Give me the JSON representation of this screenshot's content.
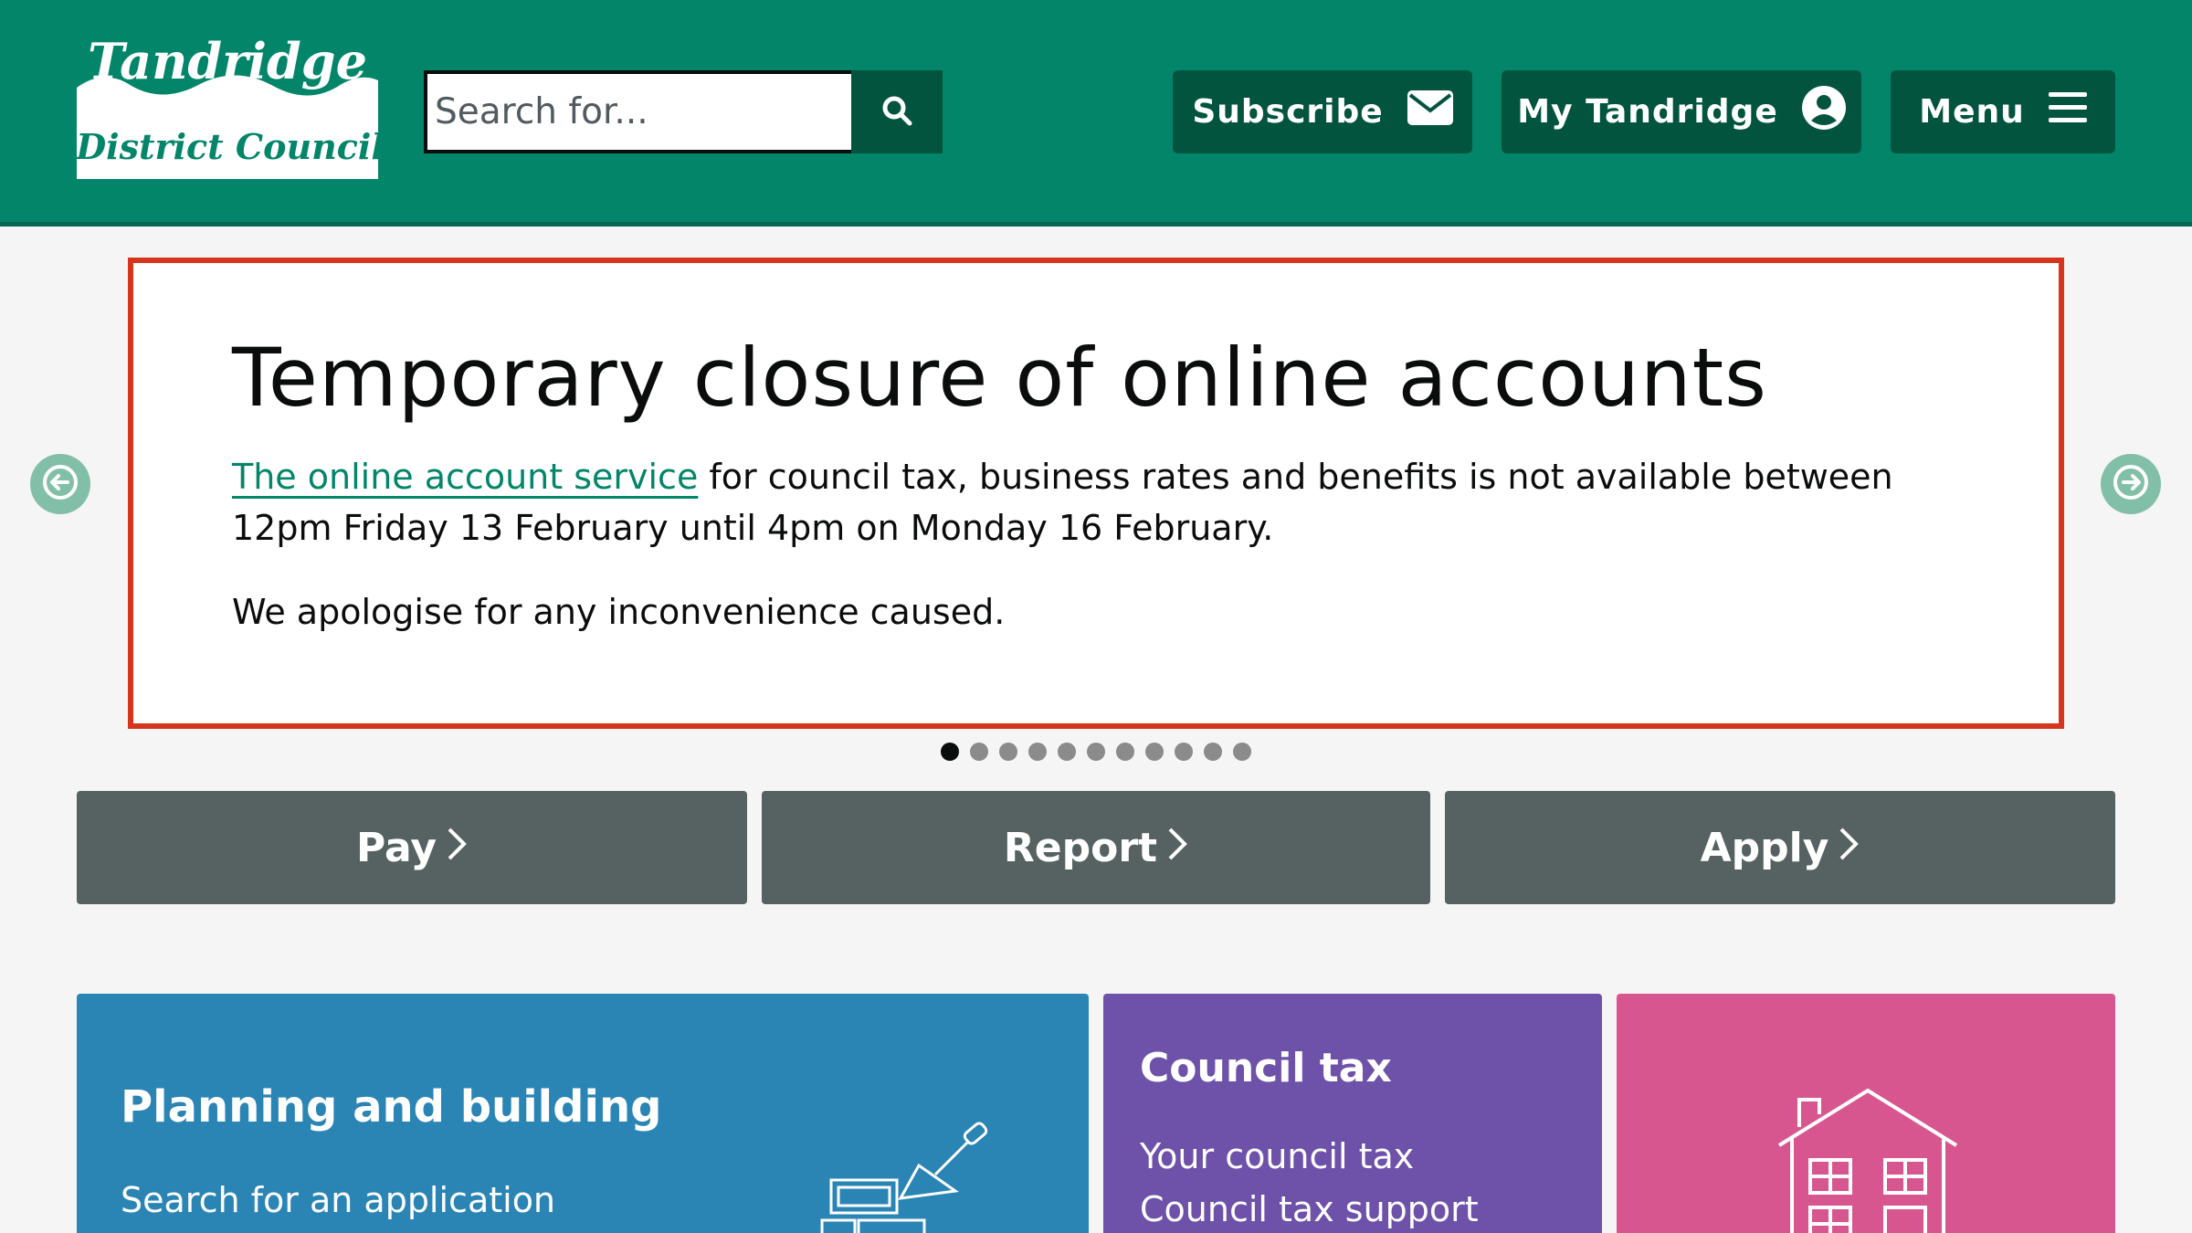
{
  "header": {
    "logo_line1": "Tandridge",
    "logo_line2": "District Council",
    "search_placeholder": "Search for...",
    "subscribe_label": "Subscribe",
    "my_tandridge_label": "My Tandridge",
    "menu_label": "Menu"
  },
  "notice": {
    "title": "Temporary closure of online accounts",
    "link_text": "The online account service",
    "body_text": " for council tax, business rates and benefits is not available between 12pm Friday 13 February until 4pm on Monday 16 February.",
    "apology": "We apologise for any inconvenience caused."
  },
  "carousel": {
    "slide_count": 11,
    "active_index": 0
  },
  "actions": {
    "pay": "Pay",
    "report": "Report",
    "apply": "Apply"
  },
  "tiles": {
    "planning": {
      "title": "Planning and building",
      "links": [
        "Search for an application"
      ]
    },
    "council_tax": {
      "title": "Council tax",
      "links": [
        "Your council tax",
        "Council tax support"
      ]
    }
  },
  "icons": [
    "search-icon",
    "envelope-icon",
    "user-circle-icon",
    "hamburger-icon",
    "arrow-left-icon",
    "arrow-right-icon",
    "chevron-right-icon",
    "bricks-trowel-icon",
    "house-icon"
  ],
  "colors": {
    "header_green": "#03856a",
    "button_dark_green": "#03543f",
    "notice_border_red": "#d4351c",
    "action_grey": "#566262",
    "planning_blue": "#2a85b5",
    "council_purple": "#6e51a8",
    "housing_pink": "#d8568f"
  }
}
